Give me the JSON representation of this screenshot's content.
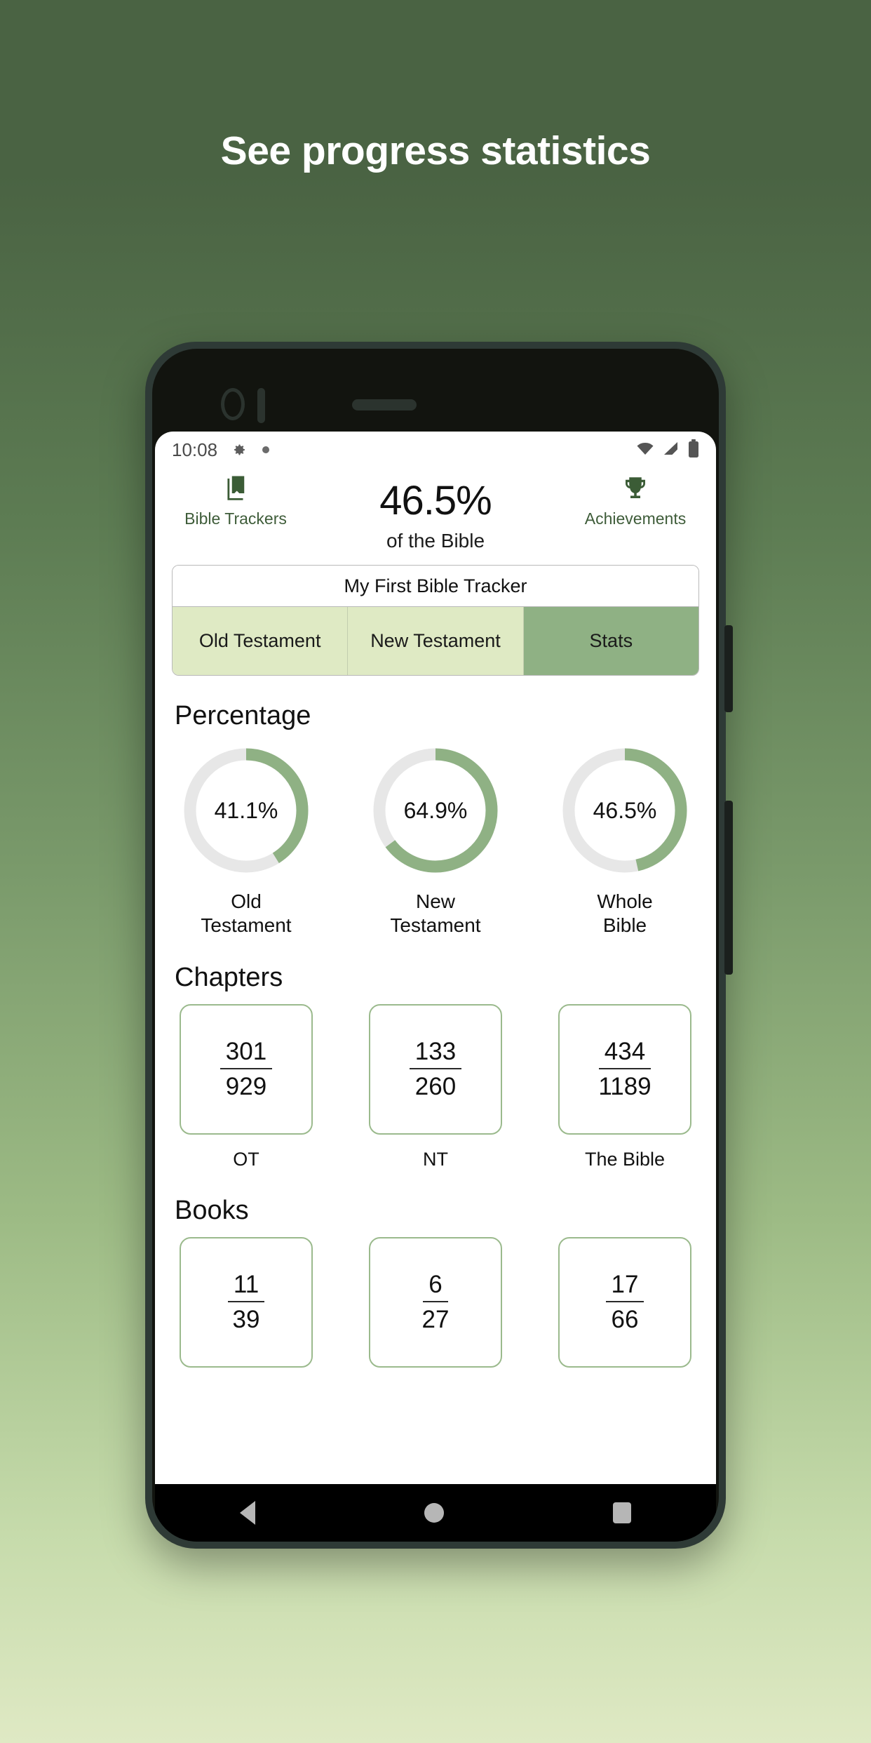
{
  "promo": {
    "headline": "See progress statistics"
  },
  "status_bar": {
    "time": "10:08",
    "gear_icon": "gear-icon",
    "dot_icon": "dot-icon",
    "wifi_icon": "wifi-icon",
    "signal_icon": "signal-icon",
    "battery_icon": "battery-icon"
  },
  "app_header": {
    "left": {
      "icon": "book-bookmark-icon",
      "label": "Bible Trackers"
    },
    "right": {
      "icon": "trophy-icon",
      "label": "Achievements"
    },
    "percent": "46.5%",
    "subtitle": "of the Bible"
  },
  "tracker": {
    "title": "My First Bible Tracker",
    "tabs": [
      {
        "label": "Old Testament",
        "active": false
      },
      {
        "label": "New Testament",
        "active": false
      },
      {
        "label": "Stats",
        "active": true
      }
    ]
  },
  "sections": {
    "percentage_title": "Percentage",
    "chapters_title": "Chapters",
    "books_title": "Books"
  },
  "colors": {
    "accent_green": "#8fb184",
    "ring_track": "#e7e7e7",
    "tab_inactive": "#dfeac4",
    "tab_active": "#8fb184",
    "card_border": "#9bba8d",
    "header_text_green": "#3e5c39",
    "bg_top": "#4a6343",
    "bg_bottom": "#dfe9c4"
  },
  "chart_data": [
    {
      "type": "pie",
      "title": "Percentage",
      "subtype": "donut-gauge",
      "categories": [
        "Old Testament",
        "New Testament",
        "Whole Bible"
      ],
      "values": [
        41.1,
        64.9,
        46.5
      ],
      "value_labels": [
        "41.1%",
        "64.9%",
        "46.5%"
      ],
      "labels_multiline": [
        [
          "Old",
          "Testament"
        ],
        [
          "New",
          "Testament"
        ],
        [
          "Whole",
          "Bible"
        ]
      ],
      "unit": "%",
      "range": [
        0,
        100
      ],
      "fill_color": "#8fb184",
      "track_color": "#e7e7e7",
      "legend": "none"
    },
    {
      "type": "table",
      "title": "Chapters",
      "categories": [
        "OT",
        "NT",
        "The Bible"
      ],
      "numerators": [
        301,
        133,
        434
      ],
      "denominators": [
        929,
        260,
        1189
      ],
      "values": [
        "301/929",
        "133/260",
        "434/1189"
      ]
    },
    {
      "type": "table",
      "title": "Books",
      "categories": [
        "",
        "",
        ""
      ],
      "numerators": [
        11,
        6,
        17
      ],
      "denominators": [
        39,
        27,
        66
      ],
      "values": [
        "11/39",
        "6/27",
        "17/66"
      ]
    }
  ],
  "percentage_cells": [
    {
      "value": "41.1%",
      "pct": 41.1,
      "line1": "Old",
      "line2": "Testament"
    },
    {
      "value": "64.9%",
      "pct": 64.9,
      "line1": "New",
      "line2": "Testament"
    },
    {
      "value": "46.5%",
      "pct": 46.5,
      "line1": "Whole",
      "line2": "Bible"
    }
  ],
  "chapters_cells": [
    {
      "num": "301",
      "den": "929",
      "label": "OT"
    },
    {
      "num": "133",
      "den": "260",
      "label": "NT"
    },
    {
      "num": "434",
      "den": "1189",
      "label": "The Bible"
    }
  ],
  "books_cells": [
    {
      "num": "11",
      "den": "39",
      "label": ""
    },
    {
      "num": "6",
      "den": "27",
      "label": ""
    },
    {
      "num": "17",
      "den": "66",
      "label": ""
    }
  ],
  "nav_bar": {
    "back": "back-triangle-icon",
    "home": "home-circle-icon",
    "recents": "recents-square-icon"
  }
}
